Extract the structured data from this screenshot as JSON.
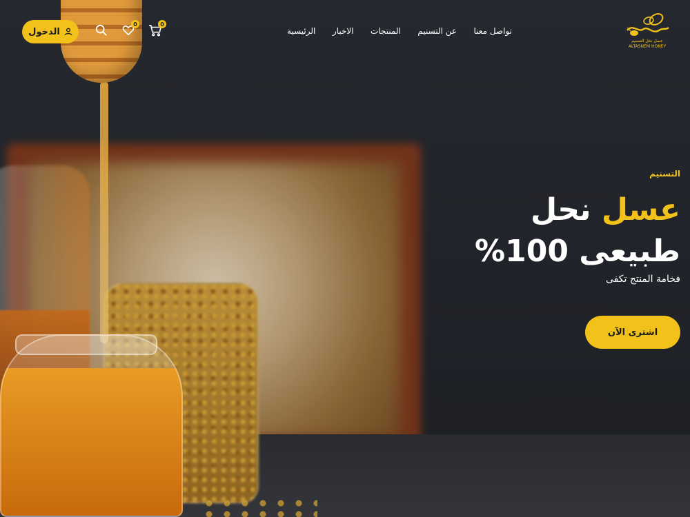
{
  "header": {
    "login_label": "الدخول",
    "wishlist_count": "0",
    "cart_count": "0",
    "nav_items": [
      {
        "label": "الرئيسية"
      },
      {
        "label": "الاخبار"
      },
      {
        "label": "المنتجات"
      },
      {
        "label": "عن التسنيم"
      },
      {
        "label": "تواصل معنا"
      }
    ],
    "logo": {
      "arabic_text": "عسل نحل التسنيم",
      "latin_text": "ALTASNEM HONEY"
    }
  },
  "hero": {
    "eyebrow": "التسنيم",
    "headline_accent": "عسل",
    "headline_rest": "نحل",
    "headline_line2": "طبيعى 100%",
    "subtitle": "فخامة المنتج تكفى",
    "cta_label": "اشترى الآن"
  },
  "colors": {
    "accent": "#f2c21b",
    "background": "#20232a",
    "text": "#ffffff"
  },
  "icons": [
    "user-icon",
    "search-icon",
    "heart-icon",
    "cart-icon",
    "bee-logo-icon"
  ]
}
